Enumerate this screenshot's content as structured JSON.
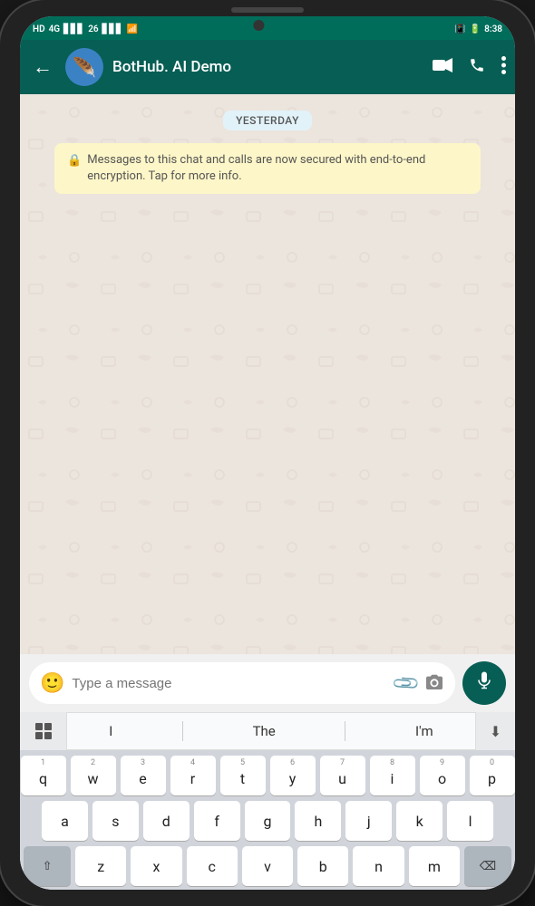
{
  "phone": {
    "status_bar": {
      "carrier1": "HD",
      "carrier2": "4G",
      "signal1": "26",
      "wifi": "WiFi",
      "battery_icon": "🔋",
      "time": "8:38"
    },
    "header": {
      "back_label": "←",
      "contact_name": "BotHub. AI Demo",
      "video_icon": "video-camera-icon",
      "phone_icon": "phone-icon",
      "more_icon": "more-vertical-icon"
    },
    "chat": {
      "date_label": "YESTERDAY",
      "encryption_message": "Messages to this chat and calls are now secured with end-to-end encryption. Tap for more info."
    },
    "input": {
      "placeholder": "Type a message",
      "emoji_icon": "emoji-icon",
      "attach_icon": "attach-icon",
      "camera_icon": "camera-icon",
      "mic_icon": "mic-icon"
    },
    "keyboard": {
      "suggestions": [
        "I",
        "The",
        "I'm"
      ],
      "rows": [
        [
          "q",
          "w",
          "e",
          "r",
          "t",
          "y",
          "u",
          "i",
          "o",
          "p"
        ],
        [
          "a",
          "s",
          "d",
          "f",
          "g",
          "h",
          "j",
          "k",
          "l"
        ],
        [
          "z",
          "x",
          "c",
          "v",
          "b",
          "n",
          "m"
        ]
      ],
      "numbers": [
        "1",
        "2",
        "3",
        "4",
        "5",
        "6",
        "7",
        "8",
        "9",
        "0"
      ]
    }
  }
}
